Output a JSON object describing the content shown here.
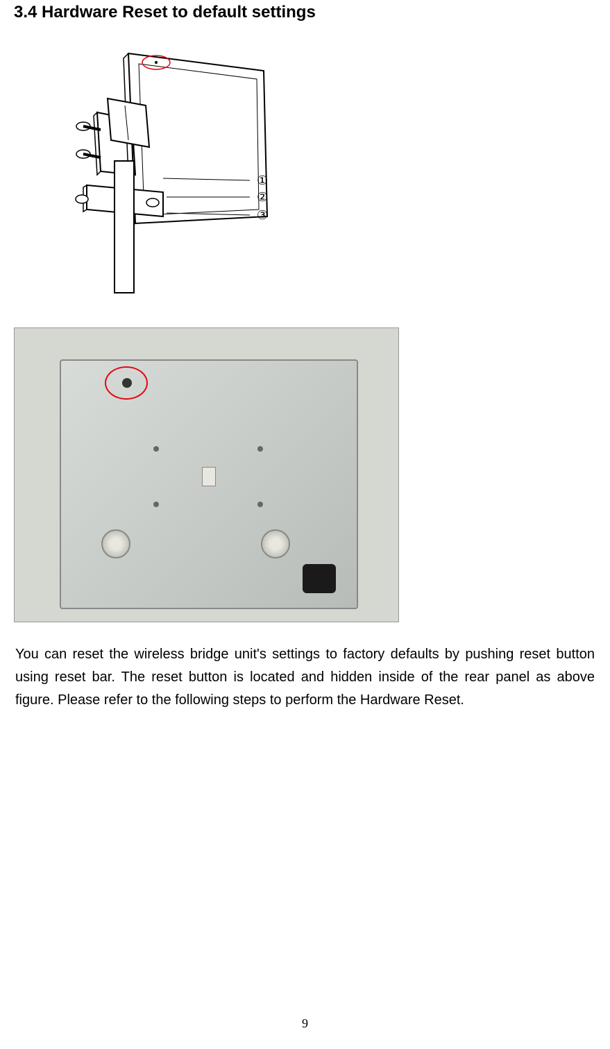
{
  "heading": "3.4 Hardware Reset to default settings",
  "diagram": {
    "labels": {
      "one": "①",
      "two": "②",
      "three": "③"
    }
  },
  "body_paragraph": "You can reset the wireless bridge unit's settings to factory defaults by pushing reset button using reset bar. The reset button is located and hidden inside of the rear panel as above figure. Please refer to the following steps to perform the Hardware Reset.",
  "page_number": "9"
}
